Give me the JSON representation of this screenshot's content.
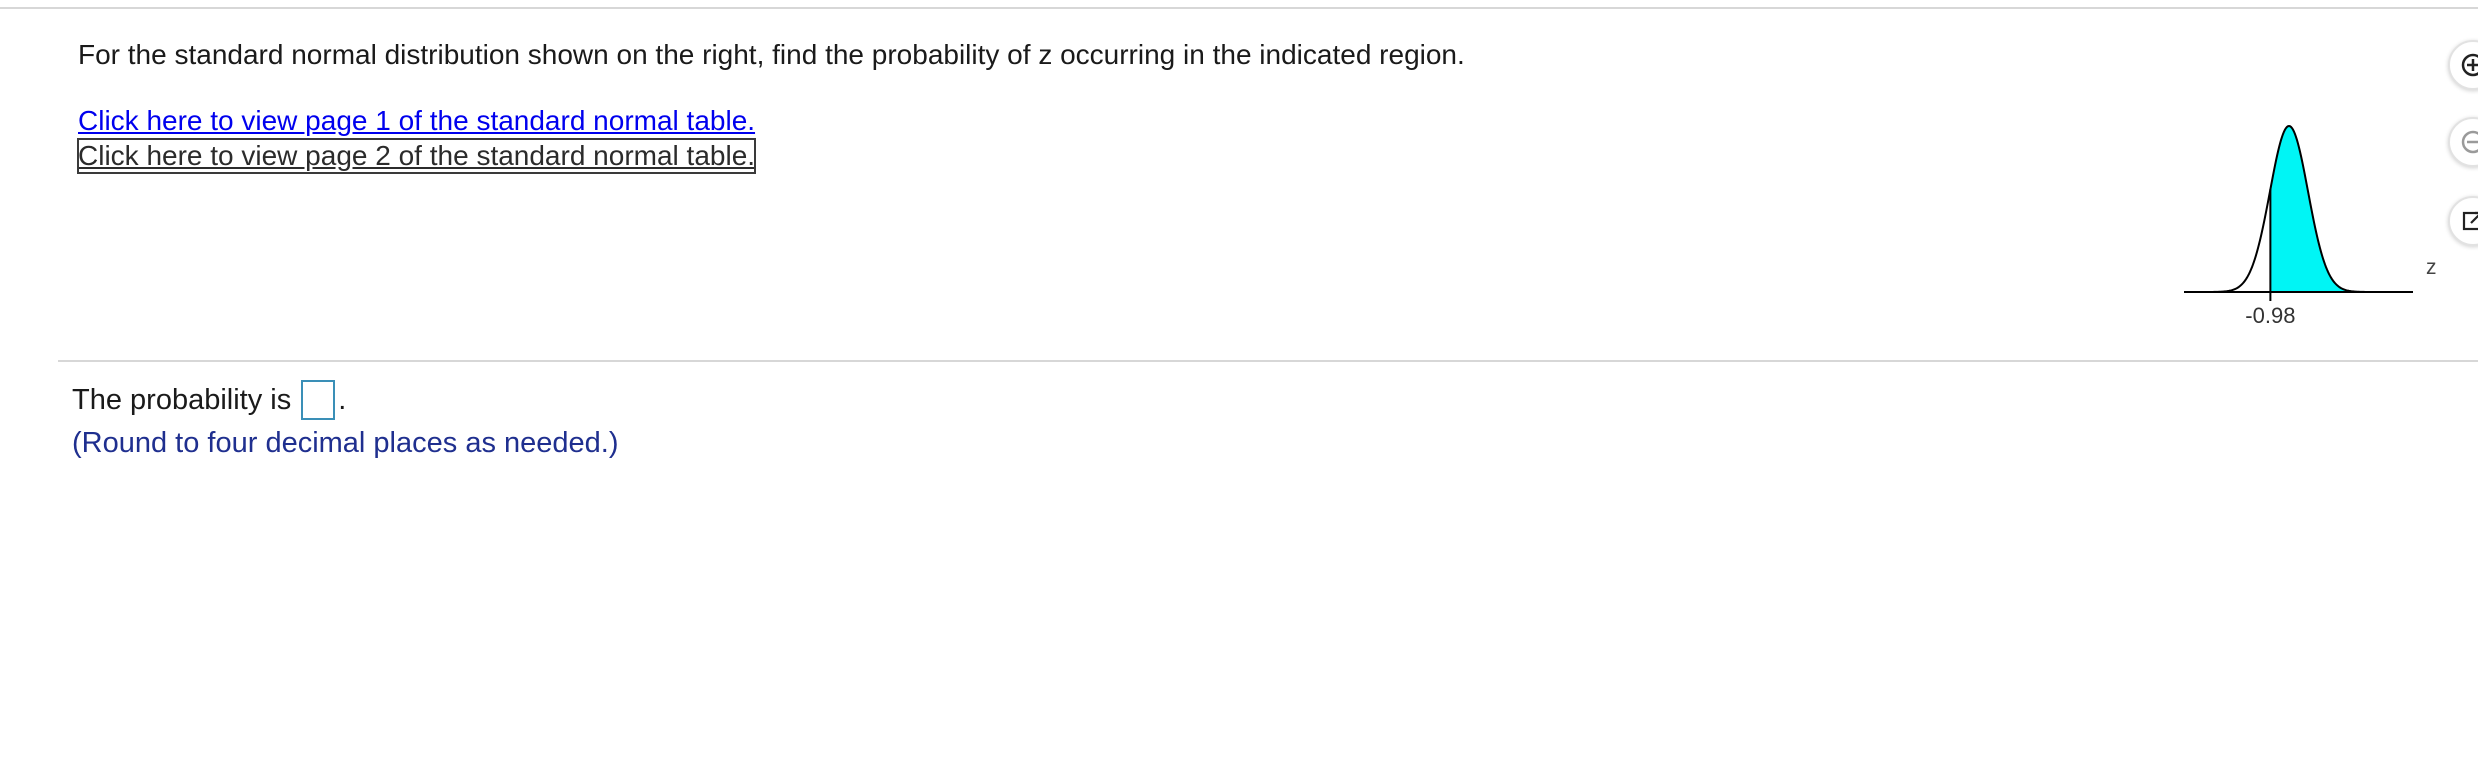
{
  "question": {
    "text": "For the standard normal distribution shown on the right, find the probability of z occurring in the indicated region.",
    "links": [
      "Click here to view page 1 of the standard normal table.",
      "Click here to view page 2 of the standard normal table."
    ]
  },
  "figure": {
    "z_value": "-0.98",
    "axis_label": "z",
    "shaded_region": "right of -0.98",
    "fill_color": "#00f5f5",
    "curve_color": "#000000"
  },
  "answer": {
    "prompt": "The probability is",
    "suffix": ".",
    "value": "",
    "hint": "(Round to four decimal places as needed.)"
  },
  "toolbar": {
    "icons": [
      "zoom-in-icon",
      "zoom-out-icon",
      "popout-icon"
    ]
  }
}
